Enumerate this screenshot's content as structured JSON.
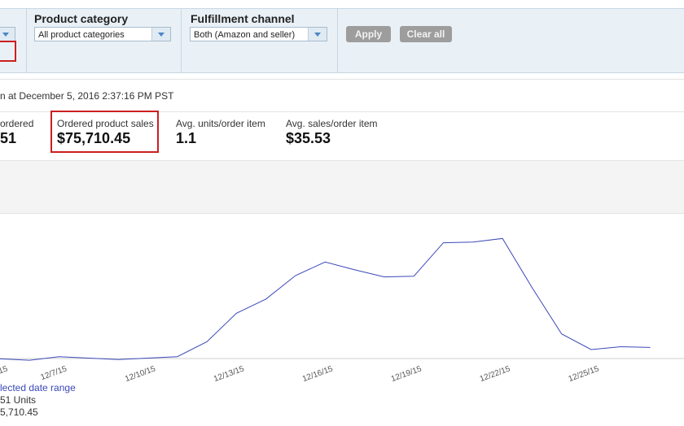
{
  "filters": {
    "date_select": "",
    "product_category": {
      "title": "Product category",
      "value": "All product categories"
    },
    "fulfillment_channel": {
      "title": "Fulfillment channel",
      "value": "Both (Amazon and seller)"
    },
    "apply_label": "Apply",
    "clear_label": "Clear all"
  },
  "updated_text": "n at December 5, 2016 2:37:16 PM PST",
  "metrics": [
    {
      "label": "ordered",
      "value": "51"
    },
    {
      "label": "Ordered product sales",
      "value": "$75,710.45"
    },
    {
      "label": "Avg. units/order item",
      "value": "1.1"
    },
    {
      "label": "Avg. sales/order item",
      "value": "$35.53"
    }
  ],
  "colors": {
    "highlight": "#cc1f1f",
    "line": "#3b49b8",
    "filter_bg": "#e9f1f7",
    "button": "#9d9d9d"
  },
  "chart_data": {
    "type": "line",
    "x": [
      "12/5/15",
      "12/6/15",
      "12/7/15",
      "12/8/15",
      "12/9/15",
      "12/10/15",
      "12/11/15",
      "12/12/15",
      "12/13/15",
      "12/14/15",
      "12/15/15",
      "12/16/15",
      "12/17/15",
      "12/18/15",
      "12/19/15",
      "12/20/15",
      "12/21/15",
      "12/22/15",
      "12/23/15",
      "12/24/15",
      "12/25/15",
      "12/26/15",
      "12/27/15"
    ],
    "series": [
      {
        "values": [
          3,
          1,
          6,
          4,
          2,
          4,
          6,
          27,
          67,
          87,
          120,
          139,
          128,
          118,
          119,
          166,
          167,
          172,
          103,
          38,
          16,
          20,
          19
        ]
      }
    ],
    "x_ticks": [
      "15",
      "12/7/15",
      "12/10/15",
      "12/13/15",
      "12/16/15",
      "12/19/15",
      "12/22/15",
      "12/25/15"
    ],
    "y_range": [
      0,
      180
    ],
    "grid": false,
    "legend": {
      "title": "lected date range",
      "lines": [
        "51 Units",
        "5,710.45"
      ],
      "position": "bottom-left"
    }
  }
}
